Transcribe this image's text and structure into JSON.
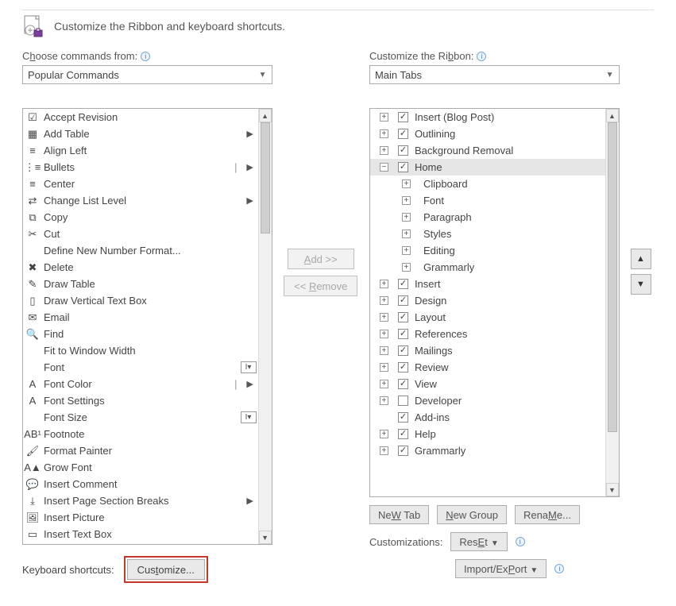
{
  "header": {
    "title": "Customize the Ribbon and keyboard shortcuts."
  },
  "left": {
    "label_pre": "C",
    "label_hot": "h",
    "label_post": "oose commands from:",
    "combo": "Popular Commands",
    "commands": [
      {
        "label": "Accept Revision",
        "icon": "accept-icon"
      },
      {
        "label": "Add Table",
        "icon": "table-icon",
        "submenu": true
      },
      {
        "label": "Align Left",
        "icon": "align-left-icon"
      },
      {
        "label": "Bullets",
        "icon": "bullets-icon",
        "submenu": true,
        "split": true
      },
      {
        "label": "Center",
        "icon": "center-icon"
      },
      {
        "label": "Change List Level",
        "icon": "list-level-icon",
        "submenu": true
      },
      {
        "label": "Copy",
        "icon": "copy-icon"
      },
      {
        "label": "Cut",
        "icon": "cut-icon"
      },
      {
        "label": "Define New Number Format...",
        "icon": "blank"
      },
      {
        "label": "Delete",
        "icon": "delete-icon"
      },
      {
        "label": "Draw Table",
        "icon": "draw-table-icon"
      },
      {
        "label": "Draw Vertical Text Box",
        "icon": "textbox-v-icon"
      },
      {
        "label": "Email",
        "icon": "email-icon"
      },
      {
        "label": "Find",
        "icon": "find-icon"
      },
      {
        "label": "Fit to Window Width",
        "icon": "blank"
      },
      {
        "label": "Font",
        "icon": "blank",
        "extra": "I"
      },
      {
        "label": "Font Color",
        "icon": "font-color-icon",
        "submenu": true,
        "split": true
      },
      {
        "label": "Font Settings",
        "icon": "font-settings-icon"
      },
      {
        "label": "Font Size",
        "icon": "blank",
        "extra": "I"
      },
      {
        "label": "Footnote",
        "icon": "footnote-icon"
      },
      {
        "label": "Format Painter",
        "icon": "format-painter-icon"
      },
      {
        "label": "Grow Font",
        "icon": "grow-font-icon"
      },
      {
        "label": "Insert Comment",
        "icon": "comment-icon"
      },
      {
        "label": "Insert Page  Section Breaks",
        "icon": "breaks-icon",
        "submenu": true
      },
      {
        "label": "Insert Picture",
        "icon": "picture-icon"
      },
      {
        "label": "Insert Text Box",
        "icon": "textbox-icon"
      }
    ]
  },
  "mid": {
    "add_pre": "",
    "add_hot": "A",
    "add_post": "dd >>",
    "remove_pre": "<< ",
    "remove_hot": "R",
    "remove_post": "emove"
  },
  "right": {
    "label_pre": "Customize the Ri",
    "label_hot": "b",
    "label_post": "bon:",
    "combo": "Main Tabs",
    "tree": [
      {
        "depth": 0,
        "exp": "+",
        "chk": true,
        "label": "Insert (Blog Post)"
      },
      {
        "depth": 0,
        "exp": "+",
        "chk": true,
        "label": "Outlining"
      },
      {
        "depth": 0,
        "exp": "+",
        "chk": true,
        "label": "Background Removal"
      },
      {
        "depth": 0,
        "exp": "-",
        "chk": true,
        "label": "Home",
        "selected": true
      },
      {
        "depth": 1,
        "exp": "+",
        "label": "Clipboard"
      },
      {
        "depth": 1,
        "exp": "+",
        "label": "Font"
      },
      {
        "depth": 1,
        "exp": "+",
        "label": "Paragraph"
      },
      {
        "depth": 1,
        "exp": "+",
        "label": "Styles"
      },
      {
        "depth": 1,
        "exp": "+",
        "label": "Editing"
      },
      {
        "depth": 1,
        "exp": "+",
        "label": "Grammarly"
      },
      {
        "depth": 0,
        "exp": "+",
        "chk": true,
        "label": "Insert"
      },
      {
        "depth": 0,
        "exp": "+",
        "chk": true,
        "label": "Design"
      },
      {
        "depth": 0,
        "exp": "+",
        "chk": true,
        "label": "Layout"
      },
      {
        "depth": 0,
        "exp": "+",
        "chk": true,
        "label": "References"
      },
      {
        "depth": 0,
        "exp": "+",
        "chk": true,
        "label": "Mailings"
      },
      {
        "depth": 0,
        "exp": "+",
        "chk": true,
        "label": "Review"
      },
      {
        "depth": 0,
        "exp": "+",
        "chk": true,
        "label": "View"
      },
      {
        "depth": 0,
        "exp": "+",
        "chk": false,
        "label": "Developer"
      },
      {
        "depth": 0,
        "exp": "",
        "chk": true,
        "label": "Add-ins"
      },
      {
        "depth": 0,
        "exp": "+",
        "chk": true,
        "label": "Help"
      },
      {
        "depth": 0,
        "exp": "+",
        "chk": true,
        "label": "Grammarly"
      }
    ],
    "newtab_hot": "W",
    "newtab_pre": "Ne",
    "newtab_post": " Tab",
    "newgroup_hot": "N",
    "newgroup_post": "ew Group",
    "rename_hot": "M",
    "rename_pre": "Rena",
    "rename_post": "e...",
    "cust_label": "Customizations:",
    "reset_hot": "E",
    "reset_pre": "Res",
    "reset_post": "t",
    "import_hot": "P",
    "import_pre": "Import/Ex",
    "import_post": "ort"
  },
  "kbd": {
    "label": "Keyboard shortcuts:",
    "btn_pre": "Cus",
    "btn_hot": "t",
    "btn_post": "omize..."
  }
}
